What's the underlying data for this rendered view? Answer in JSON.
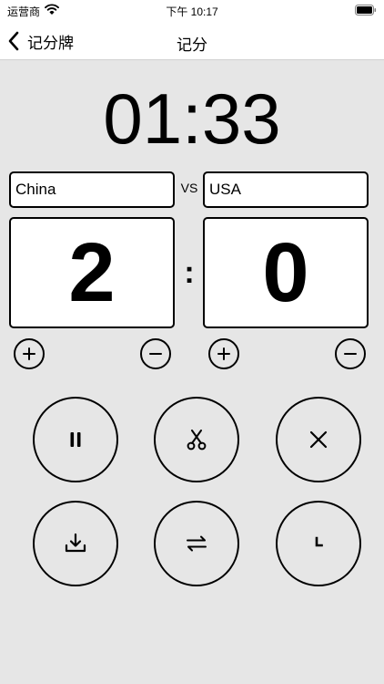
{
  "status_bar": {
    "carrier": "运营商",
    "time": "下午 10:17",
    "icons": [
      "wifi-icon",
      "battery-icon"
    ]
  },
  "nav": {
    "back_label": "记分牌",
    "title": "记分",
    "icons": [
      "chevron-left-icon"
    ]
  },
  "timer": "01:33",
  "teams": {
    "left": {
      "name": "China",
      "score": "2"
    },
    "right": {
      "name": "USA",
      "score": "0"
    },
    "vs": "VS",
    "separator": ":"
  },
  "score_controls": [
    "plus-icon",
    "minus-icon",
    "plus-icon",
    "minus-icon"
  ],
  "actions": [
    {
      "name": "pause",
      "icon": "pause-icon"
    },
    {
      "name": "scissors",
      "icon": "scissors-icon"
    },
    {
      "name": "close",
      "icon": "close-icon"
    },
    {
      "name": "download",
      "icon": "download-icon"
    },
    {
      "name": "swap",
      "icon": "swap-icon"
    },
    {
      "name": "clock",
      "icon": "clock-icon"
    }
  ]
}
